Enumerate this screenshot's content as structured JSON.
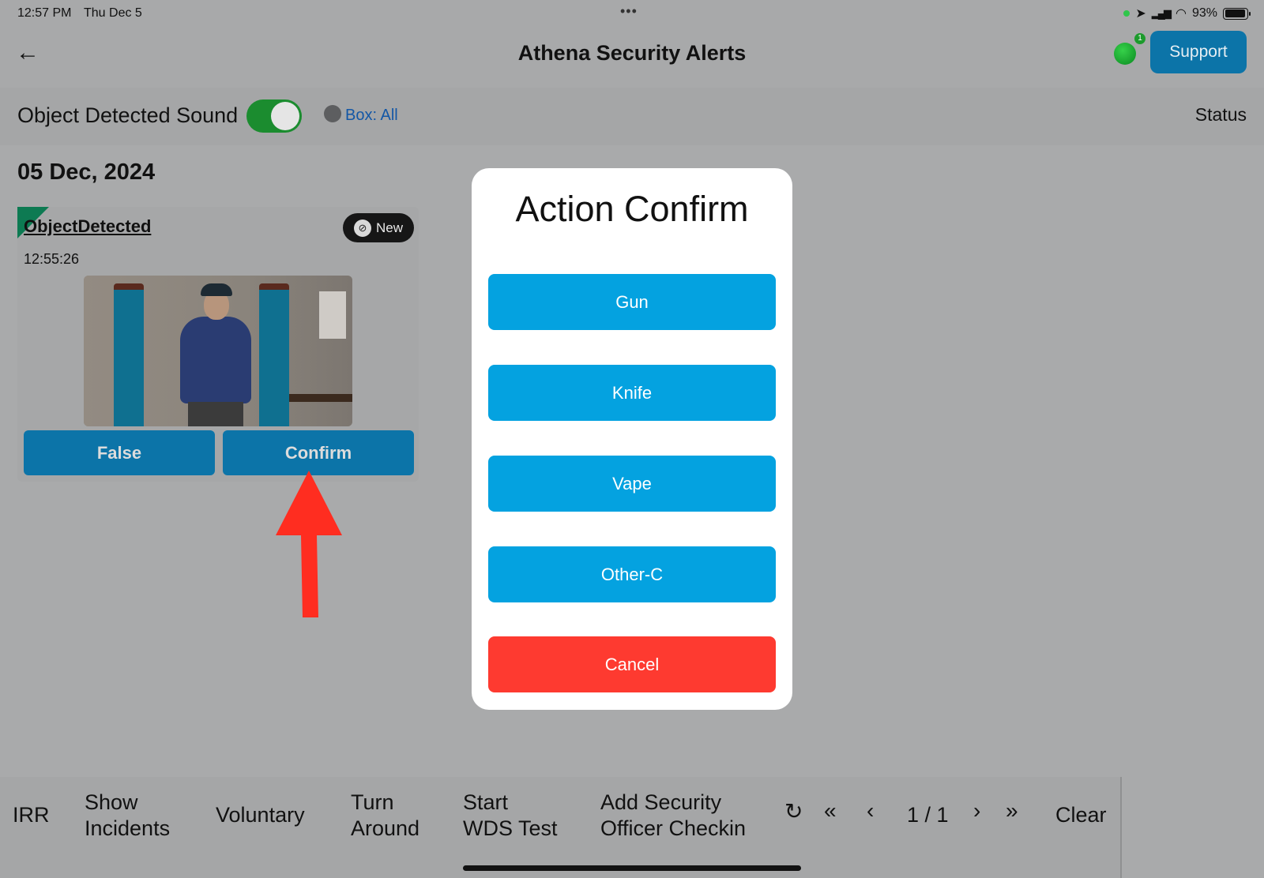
{
  "status_bar": {
    "time": "12:57 PM",
    "date": "Thu Dec 5",
    "battery": "93%",
    "battery_level": 0.93
  },
  "nav": {
    "title": "Athena Security Alerts",
    "notification_count": "1",
    "support_label": "Support"
  },
  "toolbar": {
    "sound_label": "Object Detected Sound",
    "sound_enabled": true,
    "box_filter": "Box: All",
    "status_label": "Status"
  },
  "content": {
    "date_heading": "05 Dec, 2024",
    "alert": {
      "title": "ObjectDetected",
      "badge": "New",
      "time": "12:55:26",
      "false_label": "False",
      "confirm_label": "Confirm"
    }
  },
  "modal": {
    "title": "Action Confirm",
    "options": [
      {
        "label": "Gun"
      },
      {
        "label": "Knife"
      },
      {
        "label": "Vape"
      },
      {
        "label": "Other-C"
      }
    ],
    "cancel_label": "Cancel"
  },
  "bottom_bar": {
    "items": [
      {
        "label": "IRR"
      },
      {
        "label": "Show\nIncidents"
      },
      {
        "label": "Voluntary"
      },
      {
        "label": "Turn\nAround"
      },
      {
        "label": "Start\nWDS Test"
      },
      {
        "label": "Add Security\nOfficer Checkin"
      }
    ],
    "page_indicator": "1 / 1",
    "clear_label": "Clear"
  },
  "colors": {
    "accent_blue": "#04a2e0",
    "button_blue_dimmed": "#0c74a8",
    "cancel_red": "#fe3a30",
    "toggle_green": "#1b8c2f",
    "annotation_red": "#ff2d20"
  },
  "icons": {
    "back": "arrow-left-icon",
    "refresh": "refresh-icon",
    "first": "double-chevron-left-icon",
    "prev": "chevron-left-icon",
    "next": "chevron-right-icon",
    "last": "double-chevron-right-icon",
    "link": "link-icon"
  }
}
